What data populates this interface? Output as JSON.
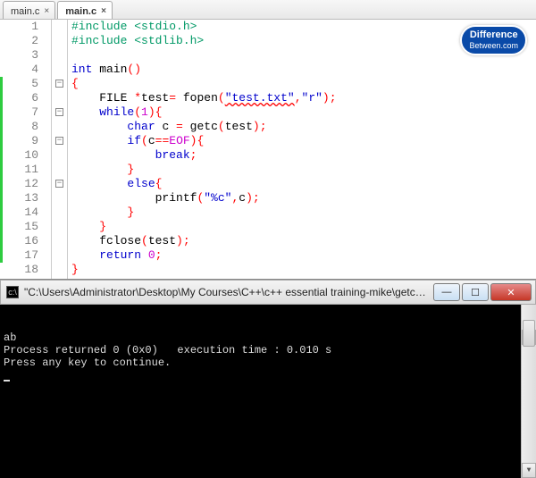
{
  "tabs": [
    {
      "label": "main.c",
      "active": false
    },
    {
      "label": "main.c",
      "active": true
    }
  ],
  "badge": {
    "line1": "Difference",
    "line2": "Between.com"
  },
  "code": {
    "lines": [
      {
        "n": 1,
        "segs": [
          [
            "pp",
            "#include <stdio.h>"
          ]
        ]
      },
      {
        "n": 2,
        "segs": [
          [
            "pp",
            "#include <stdlib.h>"
          ]
        ]
      },
      {
        "n": 3,
        "segs": []
      },
      {
        "n": 4,
        "segs": [
          [
            "kw",
            "int"
          ],
          [
            "",
            " main"
          ],
          [
            "op",
            "()"
          ]
        ]
      },
      {
        "n": 5,
        "segs": [
          [
            "op",
            "{"
          ]
        ]
      },
      {
        "n": 6,
        "segs": [
          [
            "",
            "    FILE "
          ],
          [
            "op",
            "*"
          ],
          [
            "",
            "test"
          ],
          [
            "op",
            "="
          ],
          [
            "",
            " fopen"
          ],
          [
            "op",
            "("
          ],
          [
            "err",
            "\"test.txt\""
          ],
          [
            "op",
            ","
          ],
          [
            "str",
            "\"r\""
          ],
          [
            "op",
            ");"
          ]
        ]
      },
      {
        "n": 7,
        "segs": [
          [
            "",
            "    "
          ],
          [
            "kw",
            "while"
          ],
          [
            "op",
            "("
          ],
          [
            "num",
            "1"
          ],
          [
            "op",
            ")"
          ],
          [
            "op",
            "{"
          ]
        ]
      },
      {
        "n": 8,
        "segs": [
          [
            "",
            "        "
          ],
          [
            "kw",
            "char"
          ],
          [
            "",
            " c "
          ],
          [
            "op",
            "="
          ],
          [
            "",
            " getc"
          ],
          [
            "op",
            "("
          ],
          [
            "",
            "test"
          ],
          [
            "op",
            ");"
          ]
        ]
      },
      {
        "n": 9,
        "segs": [
          [
            "",
            "        "
          ],
          [
            "kw",
            "if"
          ],
          [
            "op",
            "("
          ],
          [
            "",
            "c"
          ],
          [
            "op",
            "=="
          ],
          [
            "lit",
            "EOF"
          ],
          [
            "op",
            ")"
          ],
          [
            "op",
            "{"
          ]
        ]
      },
      {
        "n": 10,
        "segs": [
          [
            "",
            "            "
          ],
          [
            "kw",
            "break"
          ],
          [
            "op",
            ";"
          ]
        ]
      },
      {
        "n": 11,
        "segs": [
          [
            "",
            "        "
          ],
          [
            "op",
            "}"
          ]
        ]
      },
      {
        "n": 12,
        "segs": [
          [
            "",
            "        "
          ],
          [
            "kw",
            "else"
          ],
          [
            "op",
            "{"
          ]
        ]
      },
      {
        "n": 13,
        "segs": [
          [
            "",
            "            printf"
          ],
          [
            "op",
            "("
          ],
          [
            "str",
            "\"%c\""
          ],
          [
            "op",
            ","
          ],
          [
            "",
            "c"
          ],
          [
            "op",
            ");"
          ]
        ]
      },
      {
        "n": 14,
        "segs": [
          [
            "",
            "        "
          ],
          [
            "op",
            "}"
          ]
        ]
      },
      {
        "n": 15,
        "segs": [
          [
            "",
            "    "
          ],
          [
            "op",
            "}"
          ]
        ]
      },
      {
        "n": 16,
        "segs": [
          [
            "",
            "    fclose"
          ],
          [
            "op",
            "("
          ],
          [
            "",
            "test"
          ],
          [
            "op",
            ");"
          ]
        ]
      },
      {
        "n": 17,
        "segs": [
          [
            "",
            "    "
          ],
          [
            "kw",
            "return"
          ],
          [
            "",
            " "
          ],
          [
            "num",
            "0"
          ],
          [
            "op",
            ";"
          ]
        ]
      },
      {
        "n": 18,
        "segs": [
          [
            "op",
            "}"
          ]
        ]
      }
    ],
    "folds": [
      5,
      7,
      9,
      12
    ],
    "change_range": [
      5,
      17
    ]
  },
  "console": {
    "title": "\"C:\\Users\\Administrator\\Desktop\\My Courses\\C++\\c++ essential training-mike\\getc_with_files_m...",
    "lines": [
      "ab",
      "Process returned 0 (0x0)   execution time : 0.010 s",
      "Press any key to continue.",
      ""
    ]
  }
}
